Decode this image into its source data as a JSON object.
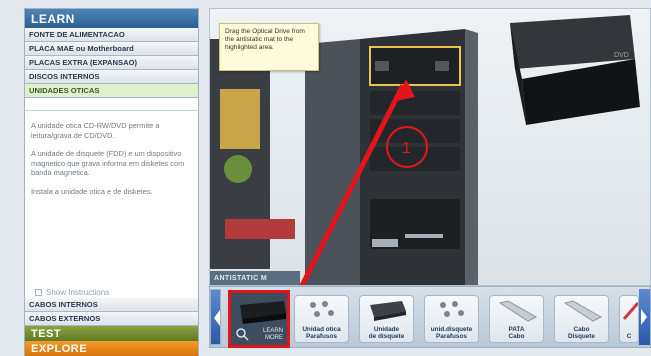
{
  "sidebar": {
    "header": "LEARN",
    "items": [
      {
        "label": "FONTE DE ALIMENTACAO"
      },
      {
        "label": "PLACA MAE ou Motherboard"
      },
      {
        "label": "PLACAS EXTRA (EXPANSAO)"
      },
      {
        "label": "DISCOS INTERNOS"
      },
      {
        "label": "UNIDADES OTICAS"
      }
    ],
    "description": [
      "A unidade otica CD-RW/DVD permite a leitura/grava de CD/DVD.",
      "A unidade de disquete (FDD) e um dispositivo magnetico que grava informa em disketes com banda magnetica.",
      "Instala a unidade otica e de disketes."
    ],
    "show_instructions": "Show Instructions",
    "bottom_items": [
      {
        "label": "CABOS INTERNOS"
      },
      {
        "label": "CABOS EXTERNOS"
      }
    ],
    "test": "TEST",
    "explore": "EXPLORE"
  },
  "scene": {
    "tooltip": "Drag the Optical Drive from the antistatic mat to the highlighted area.",
    "step_number": "1",
    "antistatic_label": "ANTISTATIC M"
  },
  "tray": {
    "learn_more": "LEARN\nMORE",
    "items": [
      {
        "label": "Unidad otica\nParafusos",
        "icon": "screws-icon"
      },
      {
        "label": "Unidade\nde disquete",
        "icon": "floppy-drive-icon"
      },
      {
        "label": "unid.disquete\nParafusos",
        "icon": "screws-icon"
      },
      {
        "label": "PATA\nCabo",
        "icon": "ribbon-cable-icon"
      },
      {
        "label": "Cabo\nDisquete",
        "icon": "ribbon-cable-icon"
      },
      {
        "label": "C",
        "icon": "cable-icon"
      }
    ]
  },
  "colors": {
    "highlight": "#e5141a",
    "accent": "#2b5f95",
    "active_item": "#dff0cf"
  }
}
